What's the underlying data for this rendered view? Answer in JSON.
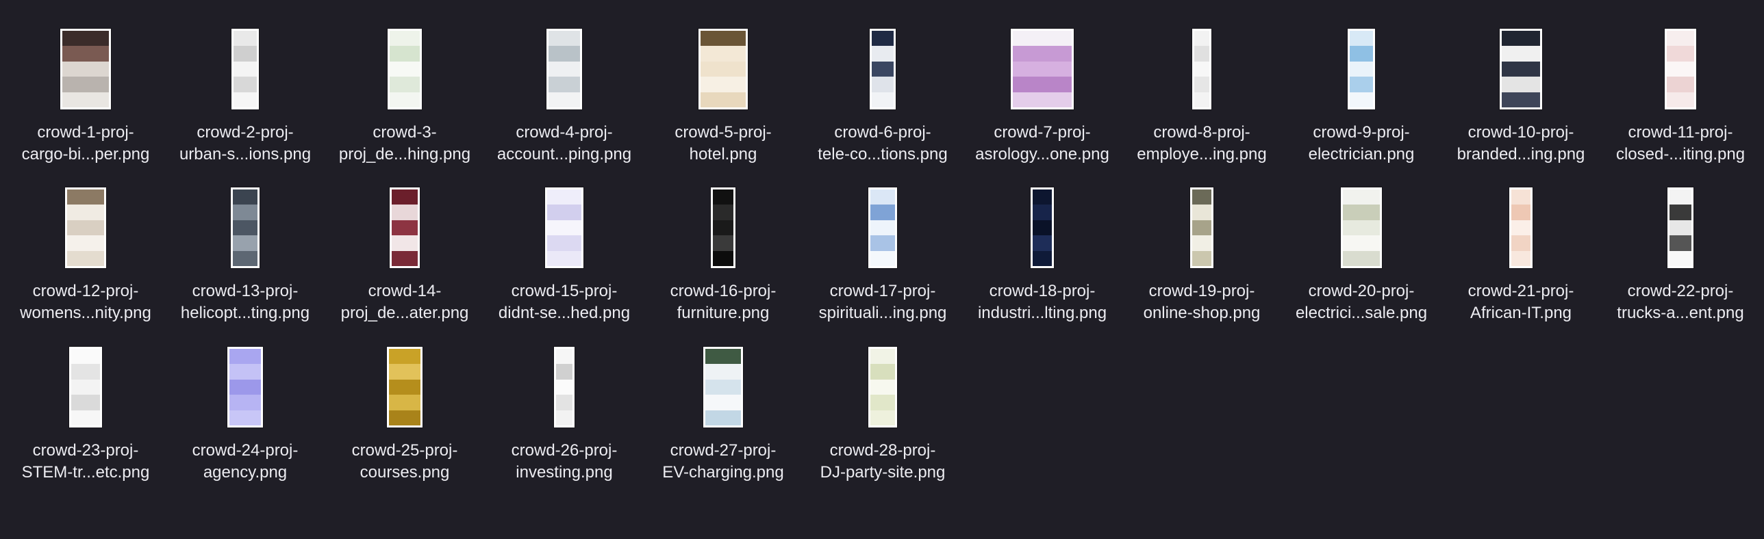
{
  "window": {
    "view": "icon-grid"
  },
  "colors": {
    "background": "#1f1e26",
    "label": "#ececf1"
  },
  "files": [
    {
      "line1": "crowd-1-proj-",
      "line2": "cargo-bi...per.png",
      "thumb": "dark-brown-hero",
      "icon": "image-file-icon"
    },
    {
      "line1": "crowd-2-proj-",
      "line2": "urban-s...ions.png",
      "thumb": "light-gray-page",
      "icon": "image-file-icon"
    },
    {
      "line1": "crowd-3-",
      "line2": "proj_de...hing.png",
      "thumb": "green-tinted-page",
      "icon": "image-file-icon"
    },
    {
      "line1": "crowd-4-proj-",
      "line2": "account...ping.png",
      "thumb": "gray-blue-page",
      "icon": "image-file-icon"
    },
    {
      "line1": "crowd-5-proj-",
      "line2": "hotel.png",
      "thumb": "cream-page",
      "icon": "image-file-icon"
    },
    {
      "line1": "crowd-6-proj-",
      "line2": "tele-co...tions.png",
      "thumb": "navy-accent-page",
      "icon": "image-file-icon"
    },
    {
      "line1": "crowd-7-proj-",
      "line2": "asrology...one.png",
      "thumb": "purple-page",
      "icon": "image-file-icon"
    },
    {
      "line1": "crowd-8-proj-",
      "line2": "employe...ing.png",
      "thumb": "light-narrow-page",
      "icon": "image-file-icon"
    },
    {
      "line1": "crowd-9-proj-",
      "line2": "electrician.png",
      "thumb": "blue-page",
      "icon": "image-file-icon"
    },
    {
      "line1": "crowd-10-proj-",
      "line2": "branded...ing.png",
      "thumb": "dark-hero-page",
      "icon": "image-file-icon"
    },
    {
      "line1": "crowd-11-proj-",
      "line2": "closed-...iting.png",
      "thumb": "pink-light-page",
      "icon": "image-file-icon"
    },
    {
      "line1": "crowd-12-proj-",
      "line2": "womens...nity.png",
      "thumb": "beige-page",
      "icon": "image-file-icon"
    },
    {
      "line1": "crowd-13-proj-",
      "line2": "helicopt...ting.png",
      "thumb": "slate-page",
      "icon": "image-file-icon"
    },
    {
      "line1": "crowd-14-",
      "line2": "proj_de...ater.png",
      "thumb": "maroon-page",
      "icon": "image-file-icon"
    },
    {
      "line1": "crowd-15-proj-",
      "line2": "didnt-se...hed.png",
      "thumb": "lavender-page",
      "icon": "image-file-icon"
    },
    {
      "line1": "crowd-16-proj-",
      "line2": "furniture.png",
      "thumb": "black-page",
      "icon": "image-file-icon"
    },
    {
      "line1": "crowd-17-proj-",
      "line2": "spirituali...ing.png",
      "thumb": "sky-page",
      "icon": "image-file-icon"
    },
    {
      "line1": "crowd-18-proj-",
      "line2": "industri...lting.png",
      "thumb": "dark-navy-page",
      "icon": "image-file-icon"
    },
    {
      "line1": "crowd-19-proj-",
      "line2": "online-shop.png",
      "thumb": "khaki-page",
      "icon": "image-file-icon"
    },
    {
      "line1": "crowd-20-proj-",
      "line2": "electrici...sale.png",
      "thumb": "mixed-light-page",
      "icon": "image-file-icon"
    },
    {
      "line1": "crowd-21-proj-",
      "line2": "African-IT.png",
      "thumb": "peach-page",
      "icon": "image-file-icon"
    },
    {
      "line1": "crowd-22-proj-",
      "line2": "trucks-a...ent.png",
      "thumb": "gray-dark-page",
      "icon": "image-file-icon"
    },
    {
      "line1": "crowd-23-proj-",
      "line2": "STEM-tr...etc.png",
      "thumb": "white-grid-page",
      "icon": "image-file-icon"
    },
    {
      "line1": "crowd-24-proj-",
      "line2": "agency.png",
      "thumb": "periwinkle-page",
      "icon": "image-file-icon"
    },
    {
      "line1": "crowd-25-proj-",
      "line2": "courses.png",
      "thumb": "gold-page",
      "icon": "image-file-icon"
    },
    {
      "line1": "crowd-26-proj-",
      "line2": "investing.png",
      "thumb": "white-slim-page",
      "icon": "image-file-icon"
    },
    {
      "line1": "crowd-27-proj-",
      "line2": "EV-charging.png",
      "thumb": "landscape-hero-page",
      "icon": "image-file-icon"
    },
    {
      "line1": "crowd-28-proj-",
      "line2": "DJ-party-site.png",
      "thumb": "sage-page",
      "icon": "image-file-icon"
    }
  ]
}
